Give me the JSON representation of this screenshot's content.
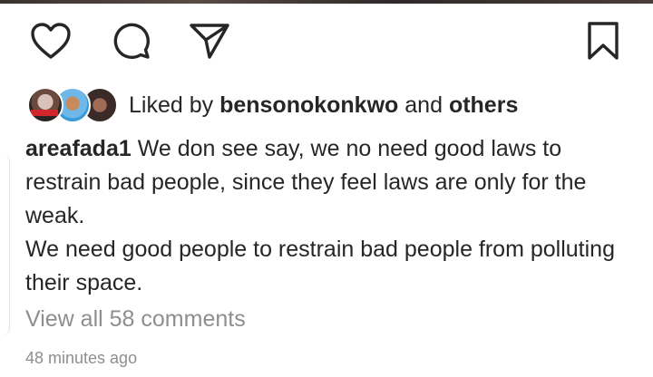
{
  "actions": {
    "like_icon": "heart-outline",
    "comment_icon": "speech-bubble-outline",
    "share_icon": "paper-plane-outline",
    "save_icon": "bookmark-outline"
  },
  "likes": {
    "prefix": "Liked by",
    "user": "bensonokonkwo",
    "conjunction": "and",
    "others": "others"
  },
  "post": {
    "username": "areafada1",
    "caption_line1": " We don see say, we no need good laws to restrain bad people, since they feel laws are only for the weak.",
    "caption_line2": "We need good people to restrain bad people from polluting their space."
  },
  "comments": {
    "view_all": "View all 58 comments"
  },
  "timestamp": "48 minutes ago",
  "colors": {
    "text": "#262626",
    "secondary": "#8e8e8e",
    "background": "#ffffff"
  }
}
